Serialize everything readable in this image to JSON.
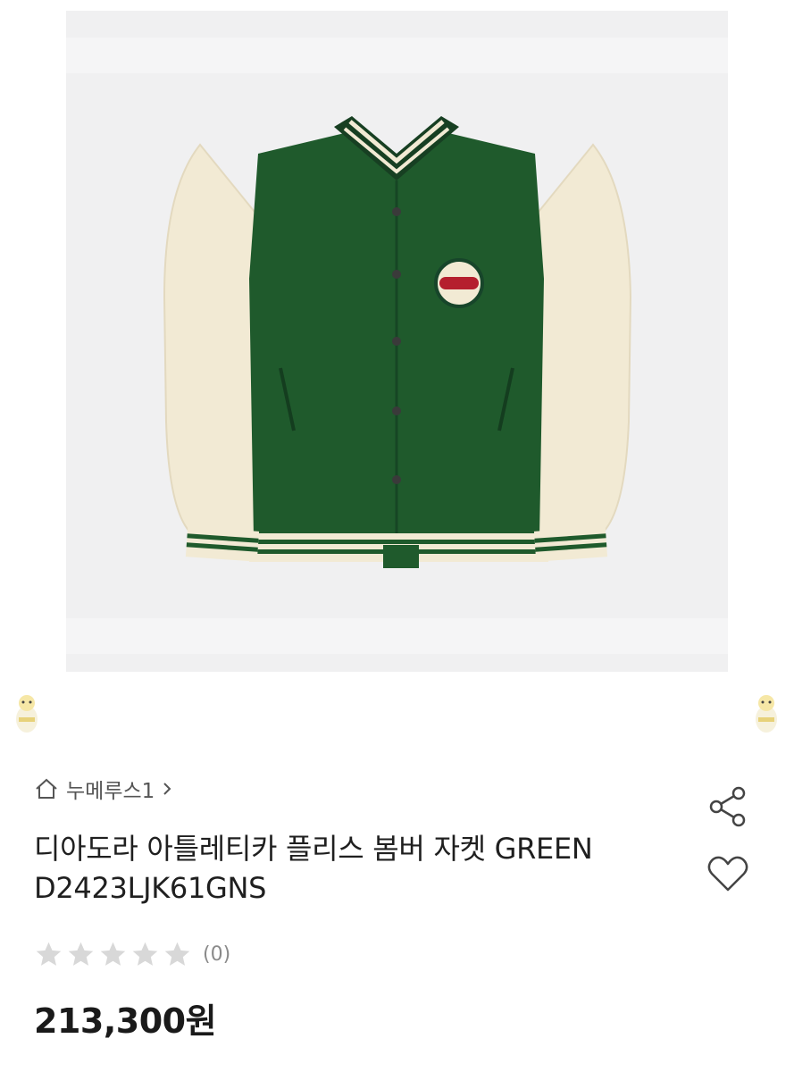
{
  "product": {
    "image_alt": "Diadora Athletica fleece bomber jacket, green body with cream sleeves",
    "seller_name": "누메루스1",
    "title_line1": "디아도라 아틀레티카 플리스 봄버 자켓 GREEN",
    "title_line2": "D2423LJK61GNS",
    "rating": {
      "stars_filled": 0,
      "stars_total": 5,
      "review_count": "(0)"
    },
    "price": "213,300원"
  },
  "icons": {
    "home": "home-icon",
    "chevron": "chevron-right-icon",
    "share": "share-icon",
    "heart": "heart-icon",
    "star": "star-icon",
    "mascot": "mascot-icon"
  },
  "colors": {
    "jacket_green": "#1f5a2c",
    "sleeve_cream": "#f2ead4",
    "image_bg": "#f0f0f1",
    "star_empty": "#d8d8d8",
    "icon_gray": "#555555"
  }
}
